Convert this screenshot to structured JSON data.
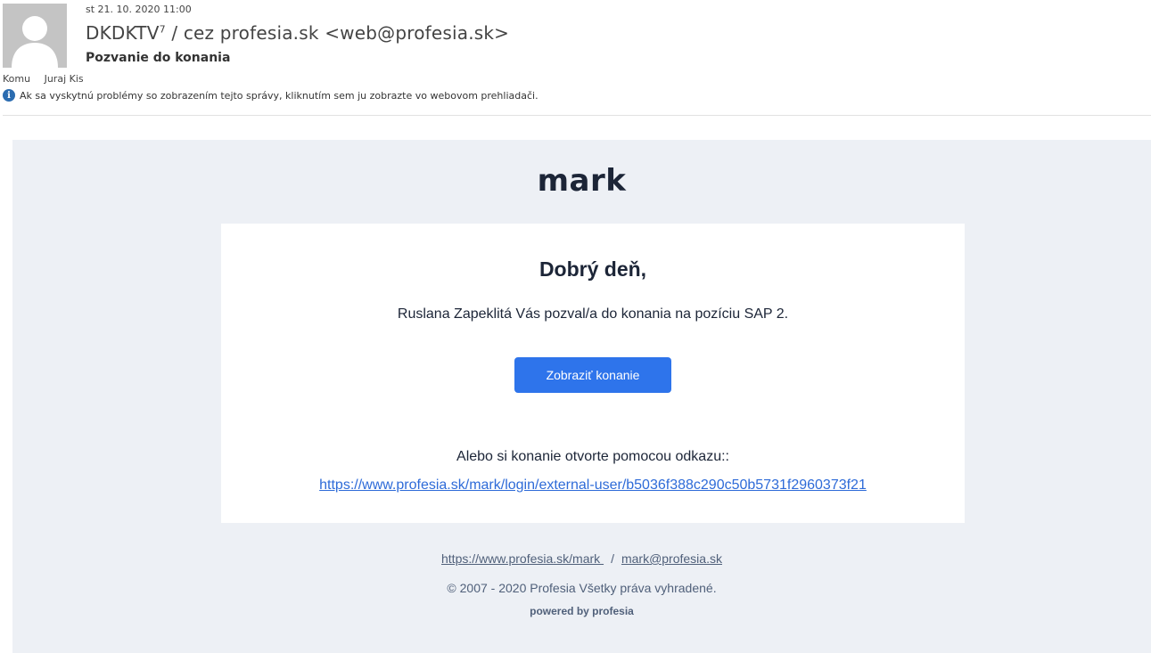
{
  "header": {
    "date": "st 21. 10. 2020 11:00",
    "sender": "DKDKTV",
    "sender_sup": "7",
    "sender_rest": " / cez profesia.sk <web@profesia.sk>",
    "subject": "Pozvanie do konania",
    "to_label": "Komu",
    "to_value": "Juraj Kis",
    "info_text": "Ak sa vyskytnú problémy so zobrazením tejto správy, kliknutím sem ju zobrazte vo webovom prehliadači."
  },
  "email": {
    "logo": "mark",
    "greeting": "Dobrý deň,",
    "invite_text": "Ruslana Zapeklitá Vás pozval/a do konania na pozíciu SAP 2.",
    "cta_label": "Zobraziť konanie",
    "alt_text": "Alebo si konanie otvorte pomocou odkazu::",
    "alt_link": "https://www.profesia.sk/mark/login/external-user/b5036f388c290c50b5731f2960373f21"
  },
  "footer": {
    "site_link": "https://www.profesia.sk/mark ",
    "separator": "/",
    "email_link": "mark@profesia.sk",
    "copyright": "© 2007 - 2020 Profesia Všetky práva vyhradené.",
    "powered": "powered by profesia"
  },
  "colors": {
    "accent": "#2e74eb",
    "link": "#2e6bd8",
    "mail_background": "#edf0f5",
    "heading": "#1c2537"
  },
  "icons": {
    "avatar": "person-placeholder-icon",
    "info": "info-icon"
  }
}
